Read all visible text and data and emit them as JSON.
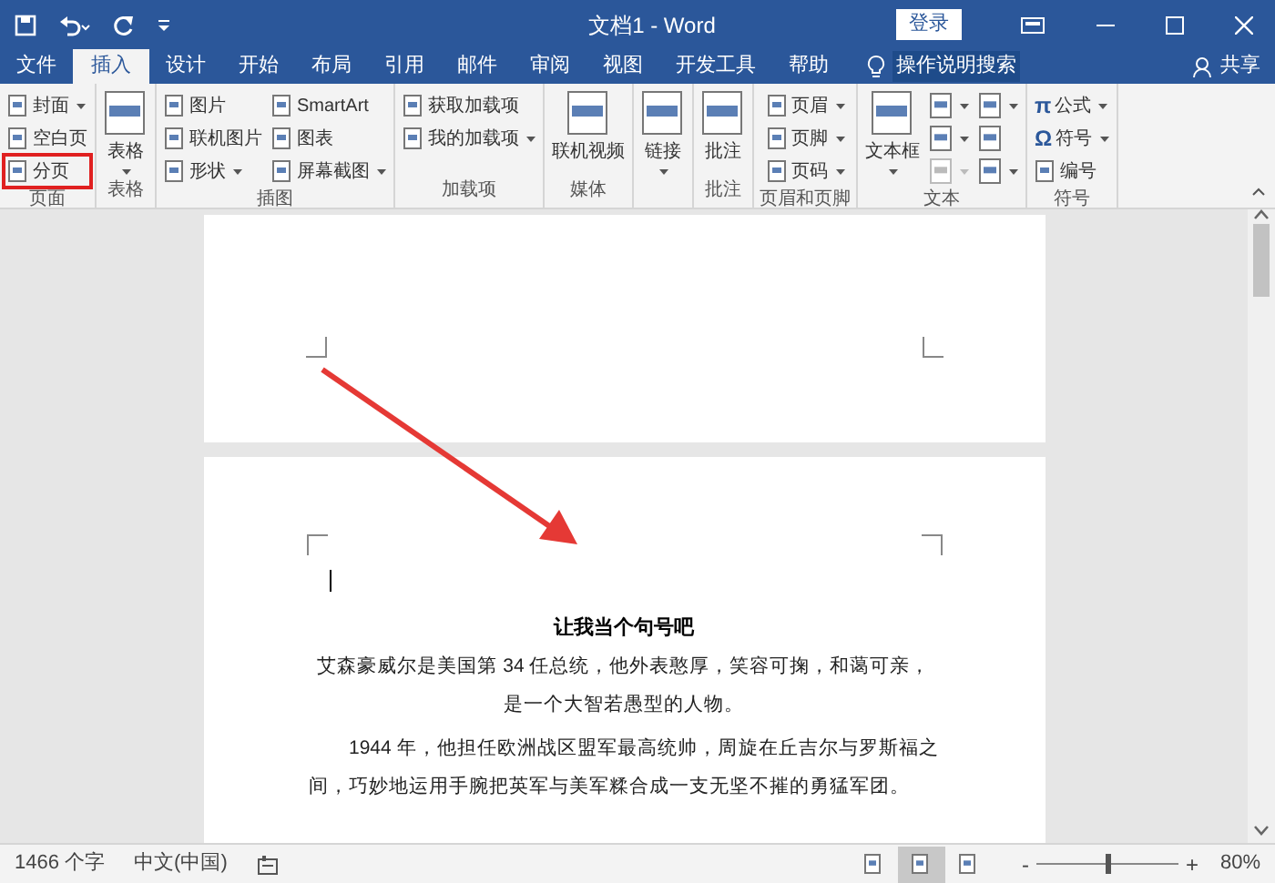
{
  "title_bar": {
    "title": "文档1 - Word",
    "login_button": "登录"
  },
  "tabs": [
    {
      "label": "文件",
      "selected": false
    },
    {
      "label": "插入",
      "selected": true
    },
    {
      "label": "设计",
      "selected": false
    },
    {
      "label": "开始",
      "selected": false
    },
    {
      "label": "布局",
      "selected": false
    },
    {
      "label": "引用",
      "selected": false
    },
    {
      "label": "邮件",
      "selected": false
    },
    {
      "label": "审阅",
      "selected": false
    },
    {
      "label": "视图",
      "selected": false
    },
    {
      "label": "开发工具",
      "selected": false
    },
    {
      "label": "帮助",
      "selected": false
    }
  ],
  "tell_me": "操作说明搜索",
  "share": "共享",
  "ribbon": [
    {
      "label": "页面",
      "columns": [
        [
          {
            "kind": "small",
            "label": "封面",
            "dropdown": true,
            "highlighted": false
          },
          {
            "kind": "small",
            "label": "空白页",
            "dropdown": false,
            "highlighted": false
          },
          {
            "kind": "small",
            "label": "分页",
            "dropdown": false,
            "highlighted": true
          }
        ]
      ]
    },
    {
      "label": "表格",
      "columns": [
        [
          {
            "kind": "large",
            "label": "表格",
            "dropdown": true
          }
        ]
      ]
    },
    {
      "label": "插图",
      "columns": [
        [
          {
            "kind": "small",
            "label": "图片",
            "dropdown": false
          },
          {
            "kind": "small",
            "label": "联机图片",
            "dropdown": false
          },
          {
            "kind": "small",
            "label": "形状",
            "dropdown": true
          }
        ],
        [
          {
            "kind": "small",
            "label": "SmartArt",
            "dropdown": false
          },
          {
            "kind": "small",
            "label": "图表",
            "dropdown": false
          },
          {
            "kind": "small",
            "label": "屏幕截图",
            "dropdown": true
          }
        ]
      ]
    },
    {
      "label": "加载项",
      "columns": [
        [
          {
            "kind": "small",
            "label": "获取加载项",
            "dropdown": false
          },
          {
            "kind": "small",
            "label": "我的加载项",
            "dropdown": true
          }
        ]
      ]
    },
    {
      "label": "媒体",
      "columns": [
        [
          {
            "kind": "large",
            "label": "联机视频",
            "dropdown": false
          }
        ]
      ]
    },
    {
      "columns": [
        [
          {
            "kind": "large",
            "label": "链接",
            "dropdown": true
          }
        ]
      ]
    },
    {
      "label": "批注",
      "columns": [
        [
          {
            "kind": "large",
            "label": "批注",
            "dropdown": false
          }
        ]
      ]
    },
    {
      "label": "页眉和页脚",
      "columns": [
        [
          {
            "kind": "small",
            "label": "页眉",
            "dropdown": true
          },
          {
            "kind": "small",
            "label": "页脚",
            "dropdown": true
          },
          {
            "kind": "small",
            "label": "页码",
            "dropdown": true
          }
        ]
      ]
    },
    {
      "label": "文本",
      "columns": [
        [
          {
            "kind": "large",
            "label": "文本框",
            "dropdown": true
          }
        ],
        [
          {
            "kind": "icon",
            "dropdown": true,
            "disabled": false
          },
          {
            "kind": "icon",
            "dropdown": true,
            "disabled": false
          },
          {
            "kind": "icon",
            "dropdown": true,
            "disabled": true
          }
        ],
        [
          {
            "kind": "icon",
            "dropdown": true,
            "disabled": false
          },
          {
            "kind": "icon",
            "dropdown": false,
            "disabled": false
          },
          {
            "kind": "icon",
            "dropdown": true,
            "disabled": false
          }
        ]
      ]
    },
    {
      "label": "符号",
      "columns": [
        [
          {
            "kind": "small",
            "label": "公式",
            "dropdown": true,
            "glyph": "π"
          },
          {
            "kind": "small",
            "label": "符号",
            "dropdown": true,
            "glyph": "Ω"
          },
          {
            "kind": "small",
            "label": "编号",
            "dropdown": false
          }
        ]
      ]
    }
  ],
  "document": {
    "title": "让我当个句号吧",
    "paragraphs": [
      {
        "text": "艾森豪威尔是美国第 34 任总统，他外表憨厚，笑容可掬，和蔼可亲，是一个大智若愚型的人物。",
        "kind": "centered"
      },
      {
        "text": "1944 年，他担任欧洲战区盟军最高统帅，周旋在丘吉尔与罗斯福之间，巧妙地运用手腕把英军与美军糅合成一支无坚不摧的勇猛军团。",
        "kind": "indented"
      }
    ]
  },
  "status_bar": {
    "word_count": "1466 个字",
    "language": "中文(中国)",
    "views": [
      {
        "selected": false
      },
      {
        "selected": true
      },
      {
        "selected": false
      }
    ],
    "zoom_out": "-",
    "zoom_slider": {
      "level": 0.5
    },
    "zoom_in": "+",
    "zoom": "80%"
  }
}
